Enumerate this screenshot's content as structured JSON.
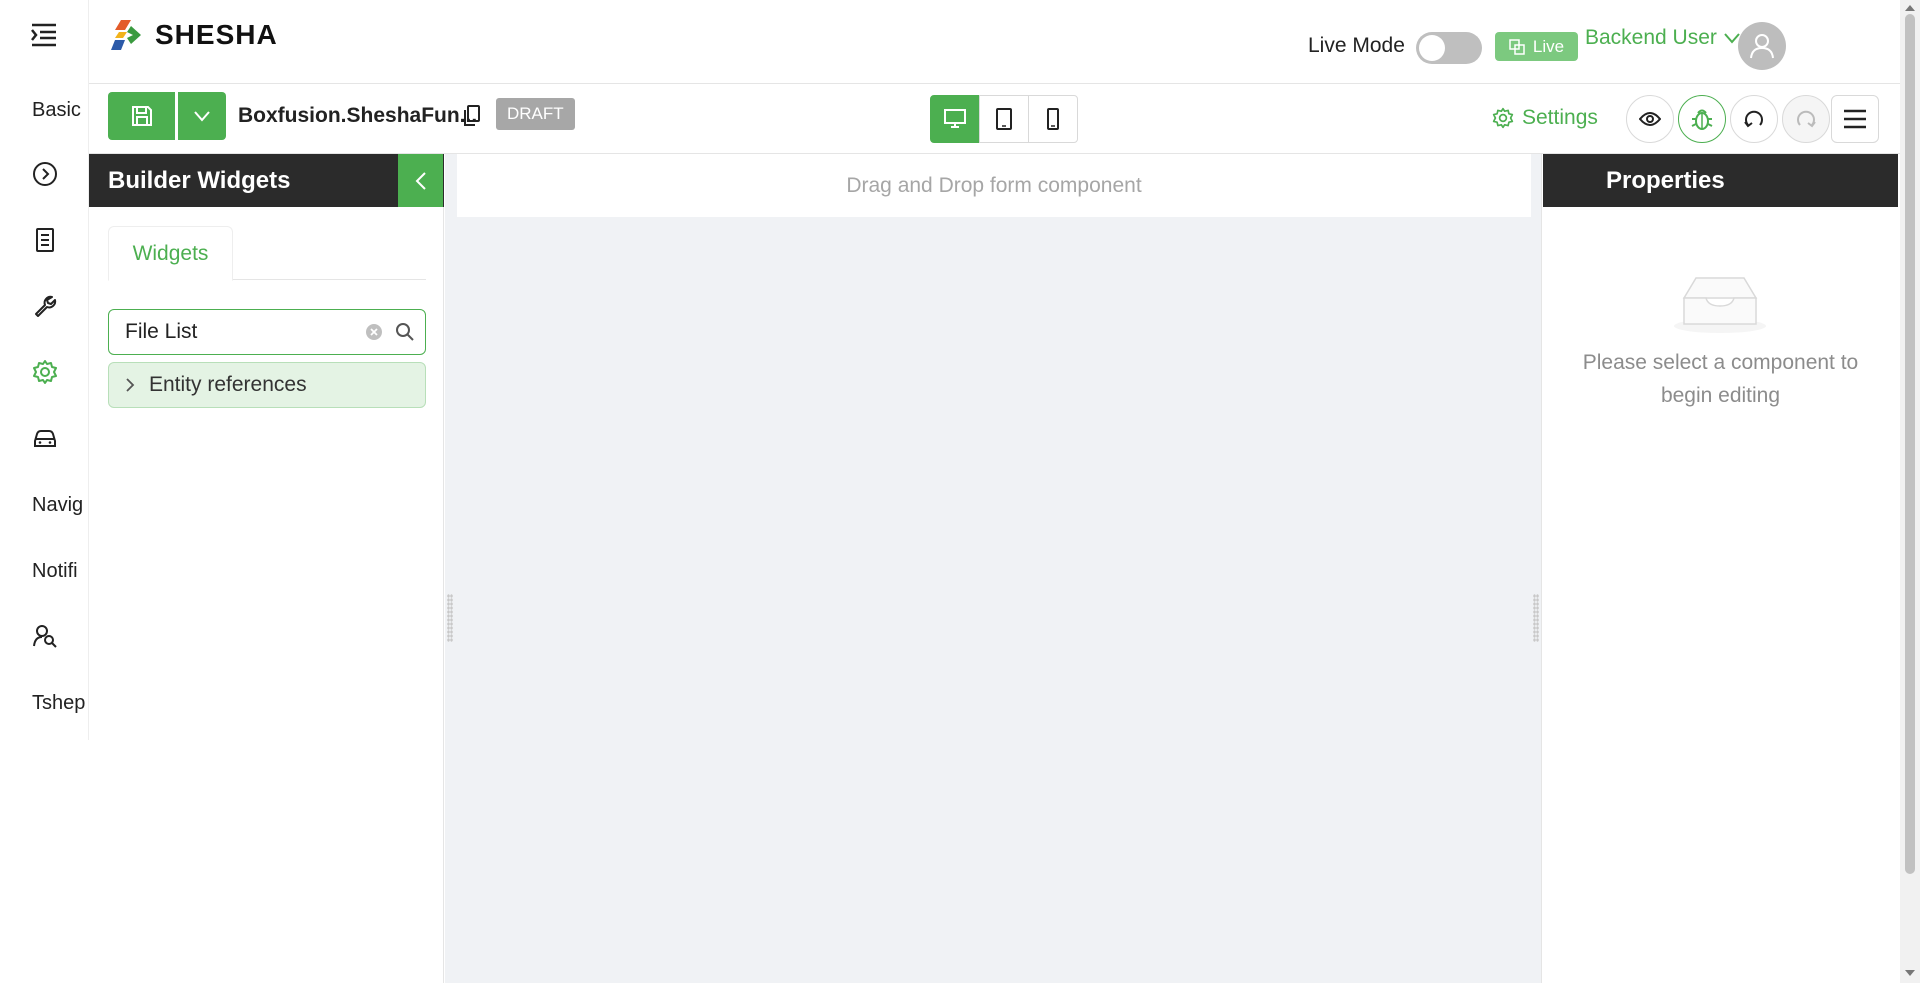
{
  "app": {
    "logo_text": "SHESHA"
  },
  "sidebar": {
    "items": [
      {
        "label": "Basic",
        "type": "text"
      },
      {
        "label": "",
        "icon": "play-circle-icon",
        "type": "icon"
      },
      {
        "label": "",
        "icon": "document-icon",
        "type": "icon"
      },
      {
        "label": "",
        "icon": "wrench-icon",
        "type": "icon"
      },
      {
        "label": "",
        "icon": "gear-icon",
        "type": "icon",
        "active": true
      },
      {
        "label": "",
        "icon": "car-icon",
        "type": "icon"
      },
      {
        "label": "Navig",
        "type": "text"
      },
      {
        "label": "Notifi",
        "type": "text"
      },
      {
        "label": "",
        "icon": "user-search-icon",
        "type": "icon"
      },
      {
        "label": "Tshep",
        "type": "text"
      }
    ]
  },
  "header": {
    "live_mode_label": "Live Mode",
    "live_mode_on": false,
    "live_button_label": "Live",
    "user_name": "Backend User"
  },
  "toolbar": {
    "form_name": "Boxfusion.SheshaFun...",
    "status_badge": "DRAFT",
    "settings_label": "Settings"
  },
  "widgets_panel": {
    "title": "Builder Widgets",
    "tab_label": "Widgets",
    "search_value": "File List",
    "categories": [
      {
        "label": "Entity references"
      }
    ]
  },
  "canvas": {
    "drop_hint": "Drag and Drop form component"
  },
  "properties_panel": {
    "title": "Properties",
    "empty_text": "Please select a component to begin editing"
  },
  "colors": {
    "accent": "#4caf50",
    "panel_header": "#2b2b2b",
    "live_badge": "#7cc97f"
  }
}
